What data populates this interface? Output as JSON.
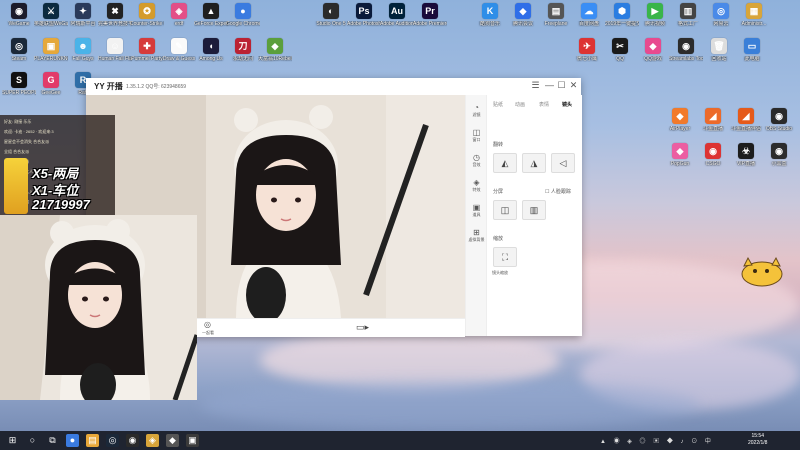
{
  "desktop": {
    "left_icons": [
      {
        "label": "WeGame",
        "color": "#1b1b2a",
        "glyph": "◉"
      },
      {
        "label": "英雄联盟WeGame版",
        "color": "#0b2a3f",
        "glyph": "⚔"
      },
      {
        "label": "阿瑞斯平台",
        "color": "#2a3a5a",
        "glyph": "✦"
      },
      {
        "label": "完美世界竞技平台",
        "color": "#222",
        "glyph": "✖"
      },
      {
        "label": "Counter-Strike Global Off...",
        "color": "#d49b2c",
        "glyph": "✪"
      },
      {
        "label": "erdf",
        "color": "#e34f87",
        "glyph": "◈"
      },
      {
        "label": "GeForce Experience",
        "color": "#1f1f1f",
        "glyph": "▲"
      },
      {
        "label": "Google Chrome",
        "color": "#3a7be0",
        "glyph": "●"
      },
      {
        "label": "Steam",
        "color": "#1b2838",
        "glyph": "◎"
      },
      {
        "label": "PLAYERUNKNOWN'S BATTLEGR...",
        "color": "#e5a83a",
        "glyph": "▣"
      },
      {
        "label": "Fall Guys",
        "color": "#4ab3e8",
        "glyph": "☻"
      },
      {
        "label": "Human Fall Flat",
        "color": "#f2f2f2",
        "glyph": "☺"
      },
      {
        "label": "Pummel Party",
        "color": "#d63b3b",
        "glyph": "✚"
      },
      {
        "label": "Draw & Guess",
        "color": "#fafafa",
        "glyph": "✎"
      },
      {
        "label": "Among Us",
        "color": "#1c1c3a",
        "glyph": "◖"
      },
      {
        "label": "永劫无间",
        "color": "#b23",
        "glyph": "刀"
      },
      {
        "label": "大富翁10Rebelion",
        "color": "#5b9f3c",
        "glyph": "◆"
      },
      {
        "label": "SUPER PEOPLE CBT",
        "color": "#111",
        "glyph": "S"
      },
      {
        "label": "GeeGee",
        "color": "#e23b6a",
        "glyph": "G"
      },
      {
        "label": "Raft",
        "color": "#2f6ea8",
        "glyph": "R"
      }
    ],
    "top_middle_icons": [
      {
        "label": "Studio One 5",
        "color": "#2b2b2b",
        "glyph": "◐"
      },
      {
        "label": "Adobe Photosh...",
        "color": "#0a1a3a",
        "glyph": "Ps"
      },
      {
        "label": "Adobe Audition ...",
        "color": "#00223a",
        "glyph": "Au"
      },
      {
        "label": "Adobe Premiere P...",
        "color": "#1a0a3a",
        "glyph": "Pr"
      }
    ],
    "right_icons": [
      {
        "label": "酷狗音乐",
        "color": "#2f8ee8",
        "glyph": "K"
      },
      {
        "label": "腾讯会议",
        "color": "#2f6ee8",
        "glyph": "◆"
      },
      {
        "label": "Freeplane",
        "color": "#555",
        "glyph": "▤"
      },
      {
        "label": "百度网盘",
        "color": "#3a8ef5",
        "glyph": "☁"
      },
      {
        "label": "2019年一键提交",
        "color": "#2a7de1",
        "glyph": "⬢"
      },
      {
        "label": "腾讯视频",
        "color": "#39b54a",
        "glyph": "▶"
      },
      {
        "label": "格式工厂",
        "color": "#444",
        "glyph": "▥"
      },
      {
        "label": "网易云",
        "color": "#4a8ae8",
        "glyph": "◎"
      },
      {
        "label": "Administr...",
        "color": "#d8a53a",
        "glyph": "▦"
      },
      {
        "label": "微七小鹰",
        "color": "#d33",
        "glyph": "✈"
      },
      {
        "label": "QQ",
        "color": "#1a1a1a",
        "glyph": "✂"
      },
      {
        "label": "QQ游戏",
        "color": "#e84a8f",
        "glyph": "◆"
      },
      {
        "label": "Streamlabs Tool",
        "color": "#2c2c2c",
        "glyph": "◉"
      },
      {
        "label": "回收站",
        "color": "#ddd",
        "glyph": "🗑"
      },
      {
        "label": "此电脑",
        "color": "#3a7fd8",
        "glyph": "▭"
      },
      {
        "label": "AirPlayer",
        "color": "#f27a2a",
        "glyph": "◆"
      },
      {
        "label": "斗鱼直播",
        "color": "#ec6a2a",
        "glyph": "◢"
      },
      {
        "label": "斗鱼直播伴侣",
        "color": "#e55a1a",
        "glyph": "◢"
      },
      {
        "label": "OBS Studio",
        "color": "#2a2a2a",
        "glyph": "◉"
      },
      {
        "label": "PopGun",
        "color": "#ec5ea2",
        "glyph": "◆"
      },
      {
        "label": "CSGO",
        "color": "#d33",
        "glyph": "◉"
      },
      {
        "label": "VIP直播",
        "color": "#1d1d1d",
        "glyph": "☣"
      },
      {
        "label": "小黑盒",
        "color": "#2c2c2c",
        "glyph": "◉"
      }
    ],
    "mascot_label": "cat sticker"
  },
  "yy_window": {
    "app_name": "YY 开播",
    "version_text": "1.35.1.2  QQ号: 623948659",
    "controls": {
      "menu": "☰",
      "minimize": "—",
      "maximize": "☐",
      "close": "✕"
    },
    "side_tools": [
      {
        "glyph": "◔",
        "label": "滤镜"
      },
      {
        "glyph": "◫",
        "label": "窗口"
      },
      {
        "glyph": "◷",
        "label": "音效"
      },
      {
        "glyph": "◈",
        "label": "特效"
      },
      {
        "glyph": "▣",
        "label": "道具"
      },
      {
        "glyph": "⊞",
        "label": "虚拟背景"
      }
    ],
    "panel": {
      "tabs": [
        {
          "label": "贴纸",
          "active": false
        },
        {
          "label": "动画",
          "active": false
        },
        {
          "label": "表情",
          "active": false
        },
        {
          "label": "镜头",
          "active": true
        }
      ],
      "section_flip": "翻转",
      "section_split": "分屏",
      "checkbox_label": "人脸跟踪",
      "section_track": "缩放",
      "track_button_label": "镜头缩放",
      "flip_buttons": [
        "◭",
        "◮",
        "◁"
      ],
      "split_buttons": [
        "◫",
        "▥"
      ]
    },
    "bottom": {
      "left_label": "一起看",
      "camera_icon": "camera-icon"
    }
  },
  "overlay": {
    "chat_lines": [
      "好友: 刚接 乐乐",
      "欢迎: 卡迪 · 2652 · 欢迎来:3",
      "星星会不会消失 合合友派",
      "全组 合合友派",
      "新来 合合友派",
      "小鸟说开心 大人已经同意",
      "月光 乐天小",
      "想吃烤鸡说 入入自播间",
      "发现 同一个鬼"
    ],
    "promo": [
      "X5-两局",
      "X1-车位",
      "21719997"
    ]
  },
  "taskbar": {
    "time": "15:54",
    "date": "2022/1/8",
    "pinned": [
      {
        "glyph": "⊞",
        "color": "#1f2430"
      },
      {
        "glyph": "○",
        "color": "#1f2430"
      },
      {
        "glyph": "⧉",
        "color": "#1f2430"
      },
      {
        "glyph": "●",
        "color": "#3a7be0"
      },
      {
        "glyph": "▤",
        "color": "#e8a83a"
      },
      {
        "glyph": "◎",
        "color": "#1b2838"
      },
      {
        "glyph": "◉",
        "color": "#2a2a2a"
      },
      {
        "glyph": "◈",
        "color": "#d8a53a"
      },
      {
        "glyph": "◆",
        "color": "#555"
      },
      {
        "glyph": "▣",
        "color": "#3a3a3a"
      }
    ]
  }
}
